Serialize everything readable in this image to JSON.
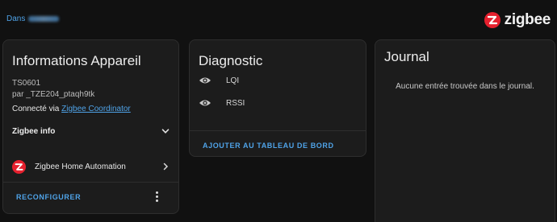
{
  "breadcrumb": {
    "prefix": "Dans",
    "area": ""
  },
  "brand": {
    "name": "zigbee",
    "color": "#e5202e"
  },
  "info_card": {
    "title": "Informations Appareil",
    "model": "TS0601",
    "manufacturer": "par _TZE204_ptaqh9tk",
    "connected_via_prefix": "Connecté via",
    "connected_via_link": "Zigbee Coordinator",
    "expander_label": "Zigbee info",
    "integration_label": "Zigbee Home Automation",
    "reconfigure_button": "RECONFIGURER"
  },
  "diagnostic_card": {
    "title": "Diagnostic",
    "rows": [
      {
        "label": "LQI",
        "icon": "eye-icon"
      },
      {
        "label": "RSSI",
        "icon": "eye-icon"
      }
    ],
    "add_button": "AJOUTER AU TABLEAU DE BORD"
  },
  "journal_card": {
    "title": "Journal",
    "empty_text": "Aucune entrée trouvée dans le journal."
  },
  "colors": {
    "accent": "#4fa3e8",
    "card_bg": "#1c1c1c",
    "page_bg": "#111111"
  }
}
